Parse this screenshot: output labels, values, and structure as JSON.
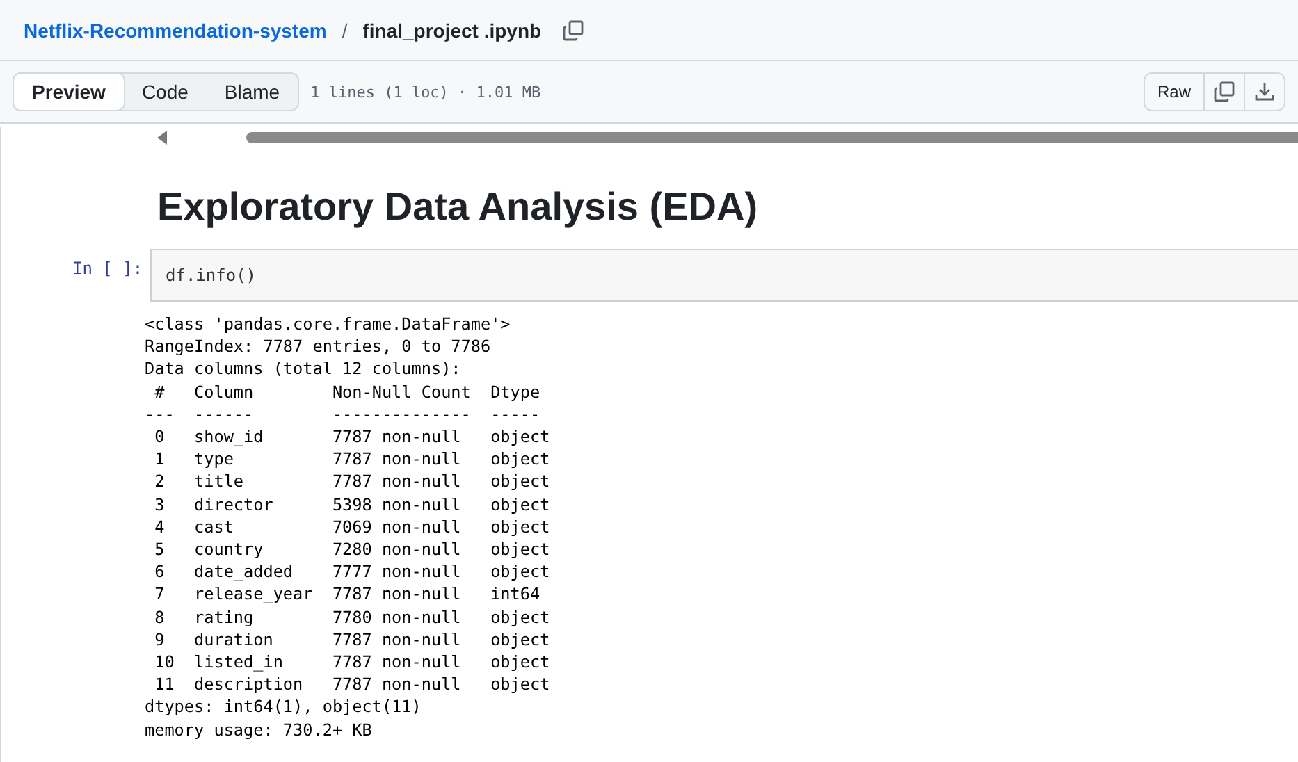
{
  "breadcrumb": {
    "repo": "Netflix-Recommendation-system",
    "separator": "/",
    "file": "final_project .ipynb"
  },
  "view_tabs": [
    {
      "label": "Preview",
      "selected": true
    },
    {
      "label": "Code",
      "selected": false
    },
    {
      "label": "Blame",
      "selected": false
    }
  ],
  "file_info": "1 lines (1 loc) · 1.01 MB",
  "actions": {
    "raw": "Raw"
  },
  "notebook": {
    "heading": "Exploratory Data Analysis (EDA)",
    "prompt": "In [ ]:",
    "code": "df.info()",
    "output": [
      "<class 'pandas.core.frame.DataFrame'>",
      "RangeIndex: 7787 entries, 0 to 7786",
      "Data columns (total 12 columns):",
      " #   Column        Non-Null Count  Dtype ",
      "---  ------        --------------  ----- ",
      " 0   show_id       7787 non-null   object",
      " 1   type          7787 non-null   object",
      " 2   title         7787 non-null   object",
      " 3   director      5398 non-null   object",
      " 4   cast          7069 non-null   object",
      " 5   country       7280 non-null   object",
      " 6   date_added    7777 non-null   object",
      " 7   release_year  7787 non-null   int64 ",
      " 8   rating        7780 non-null   object",
      " 9   duration      7787 non-null   object",
      " 10  listed_in     7787 non-null   object",
      " 11  description   7787 non-null   object",
      "dtypes: int64(1), object(11)",
      "memory usage: 730.2+ KB"
    ]
  }
}
